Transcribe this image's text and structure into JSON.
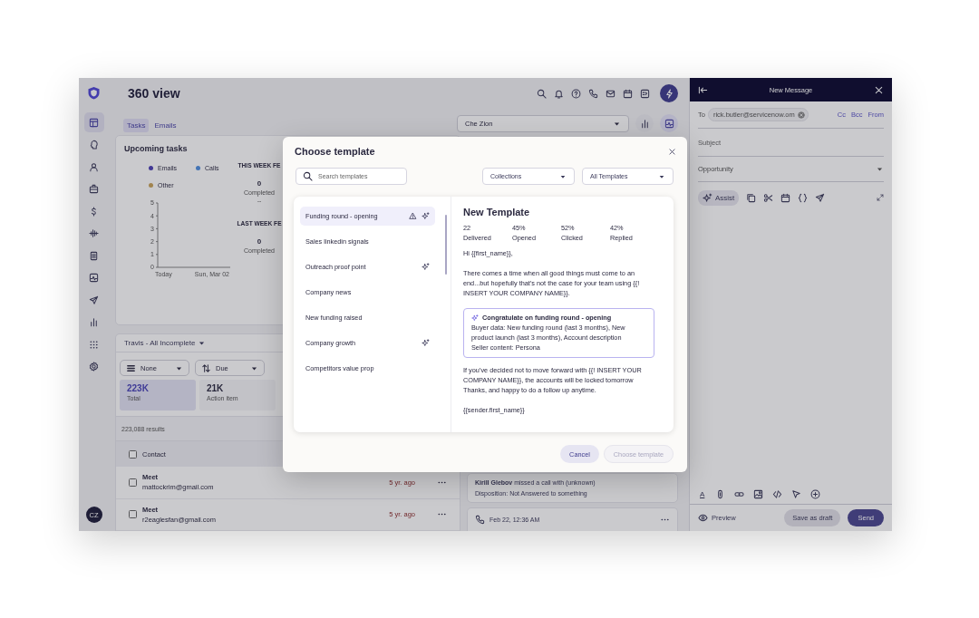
{
  "header": {
    "title": "360 view"
  },
  "sidebar": {
    "items": [
      {
        "selected": true
      },
      {
        "selected": false
      },
      {
        "selected": false
      },
      {
        "selected": false
      },
      {
        "selected": false
      },
      {
        "selected": false
      },
      {
        "selected": false
      },
      {
        "selected": false
      },
      {
        "selected": false
      },
      {
        "selected": false
      },
      {
        "selected": false
      },
      {
        "selected": false
      }
    ],
    "avatar": "CZ"
  },
  "tabs": [
    {
      "label": "Tasks",
      "selected": true
    },
    {
      "label": "Emails",
      "selected": false
    }
  ],
  "owner_select": {
    "value": "Che Zion"
  },
  "view_buttons": [
    {
      "selected": false
    },
    {
      "selected": true
    }
  ],
  "upcoming_tasks": {
    "title": "Upcoming tasks",
    "chart_data": {
      "type": "line",
      "categories": [
        "Today",
        "Sun, Mar 02"
      ],
      "ylim": [
        0,
        5
      ],
      "yticks": [
        0,
        1,
        2,
        3,
        4,
        5
      ],
      "series": [
        {
          "name": "Emails",
          "color": "#4b3fb5",
          "values": [
            null,
            null
          ]
        },
        {
          "name": "Calls",
          "color": "#4f8fe0",
          "values": [
            null,
            null
          ]
        },
        {
          "name": "Other",
          "color": "#c9a35a",
          "values": [
            null,
            null
          ]
        }
      ]
    },
    "stats": [
      {
        "heading": "THIS WEEK FE",
        "value": "0",
        "label": "Completed",
        "note": "--"
      },
      {
        "heading": "LAST WEEK FE",
        "value": "0",
        "label": "Completed"
      }
    ]
  },
  "task_list": {
    "filter": "Travis - All Incomplete",
    "group_by": "None",
    "sort": "Due",
    "tiles": [
      {
        "value": "223K",
        "label": "Total",
        "selected": true
      },
      {
        "value": "21K",
        "label": "Action item",
        "selected": false
      }
    ],
    "results": "223,088 results",
    "column_1": "Contact",
    "header_checked": false,
    "rows": [
      {
        "title": "Meet",
        "email": "mattockrim@gmail.com",
        "age": "5 yr. ago",
        "checked": false
      },
      {
        "title": "Meet",
        "email": "r2eaglesfan@gmail.com",
        "age": "5 yr. ago",
        "checked": false
      }
    ]
  },
  "activity": [
    {
      "kind": "note",
      "title": "**Kirill Glebov** missed a call with (unknown)",
      "detail": "Disposition: Not Answered to something"
    },
    {
      "kind": "call",
      "time": "Feb 22, 12:36 AM"
    }
  ],
  "compose": {
    "title": "New Message",
    "to_label": "To",
    "recipient": "rick.butler@servicenow.om",
    "links": [
      "Cc",
      "Bcc",
      "From"
    ],
    "subject_placeholder": "Subject",
    "opportunity_placeholder": "Opportunity",
    "assist": "Assist",
    "format_label": "A",
    "preview": "Preview",
    "save": "Save as draft",
    "send": "Send"
  },
  "modal": {
    "title": "Choose template",
    "search_placeholder": "Search templates",
    "filters": [
      "Collections",
      "All Templates"
    ],
    "templates": [
      {
        "name": "Funding round - opening",
        "selected": true,
        "warning": true,
        "ai": true
      },
      {
        "name": "Sales linkedin signals",
        "selected": false,
        "warning": false,
        "ai": false
      },
      {
        "name": "Outreach proof point",
        "selected": false,
        "warning": false,
        "ai": true
      },
      {
        "name": "Company news",
        "selected": false,
        "warning": false,
        "ai": false
      },
      {
        "name": "New funding raised",
        "selected": false,
        "warning": false,
        "ai": false
      },
      {
        "name": "Company growth",
        "selected": false,
        "warning": false,
        "ai": true
      },
      {
        "name": "Competitors value prop",
        "selected": false,
        "warning": false,
        "ai": false
      }
    ],
    "preview": {
      "title": "New Template",
      "stats": [
        {
          "value": "22",
          "label": "Delivered"
        },
        {
          "value": "45%",
          "label": "Opened"
        },
        {
          "value": "52%",
          "label": "Clicked"
        },
        {
          "value": "42%",
          "label": "Replied"
        }
      ],
      "intro": [
        "Hi {{first_name}},",
        "There comes a time when all good things must come to an end...but hopefully that’s not the case for your team using {{! INSERT YOUR COMPANY NAME}}."
      ],
      "ai_block": {
        "title": "Congratulate on funding round - opening",
        "lines": [
          "Buyer data: New funding round (last 3 months), New product launch (last 3 months), Account description",
          "Seller content: Persona"
        ]
      },
      "outro": [
        [
          "If you’ve decided not to move forward with {{! INSERT YOUR COMPANY NAME}}, the accounts will be locked tomorrow",
          "Thanks, and happy to do a follow up anytime."
        ],
        [
          "{{sender.first_name}}"
        ]
      ]
    },
    "buttons": [
      {
        "label": "Cancel",
        "disabled": false
      },
      {
        "label": "Choose template",
        "disabled": true
      }
    ]
  }
}
